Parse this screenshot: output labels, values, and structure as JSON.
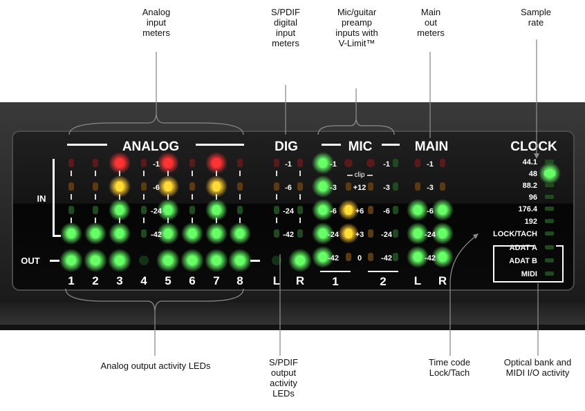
{
  "callouts_top": {
    "analog_inputs": [
      "Analog",
      "input",
      "meters"
    ],
    "spdif_inputs": [
      "S/PDIF",
      "digital",
      "input",
      "meters"
    ],
    "mic_preamp": [
      "Mic/guitar",
      "preamp",
      "inputs with",
      "V-Limit™"
    ],
    "main_out": [
      "Main",
      "out",
      "meters"
    ],
    "sample_rate": [
      "Sample",
      "rate"
    ]
  },
  "callouts_bottom": {
    "analog_outputs": [
      "Analog output activity LEDs"
    ],
    "spdif_outputs": [
      "S/PDIF",
      "output",
      "activity",
      "LEDs"
    ],
    "timecode": [
      "Time code",
      "Lock/Tach"
    ],
    "optical": [
      "Optical bank and",
      "MIDI I/O activity"
    ]
  },
  "panel": {
    "section_analog": "ANALOG",
    "section_dig": "DIG",
    "section_mic": "MIC",
    "section_main": "MAIN",
    "section_clock": "CLOCK",
    "row_in": "IN",
    "row_out": "OUT",
    "analog_channels": [
      "1",
      "2",
      "3",
      "4",
      "5",
      "6",
      "7",
      "8"
    ],
    "dig_channels": [
      "L",
      "R"
    ],
    "mic_channels": [
      "1",
      "2"
    ],
    "main_channels": [
      "L",
      "R"
    ],
    "meter_scale": [
      "-1",
      "-6",
      "-24",
      "-42"
    ],
    "mic_scale": [
      "-1",
      "-3",
      "-6",
      "-24",
      "-42"
    ],
    "vlimit_label": "clip",
    "vlimit_scale": [
      "+12",
      "+6",
      "+3",
      "0"
    ],
    "clock_rates": [
      "44.1",
      "48",
      "88.2",
      "96",
      "176.4",
      "192",
      "LOCK/TACH"
    ],
    "optical_items": [
      "ADAT A",
      "ADAT B",
      "MIDI"
    ],
    "active_clock_rate": "48"
  },
  "colors": {
    "led_green": "#66ff66",
    "led_yellow": "#ffdd33",
    "led_red": "#ff3333",
    "led_off_green": "#1f4a1f",
    "led_off_amber": "#5a3a10",
    "led_off_red": "#5a1a1a",
    "panel_dark": "#0c0c0c"
  }
}
